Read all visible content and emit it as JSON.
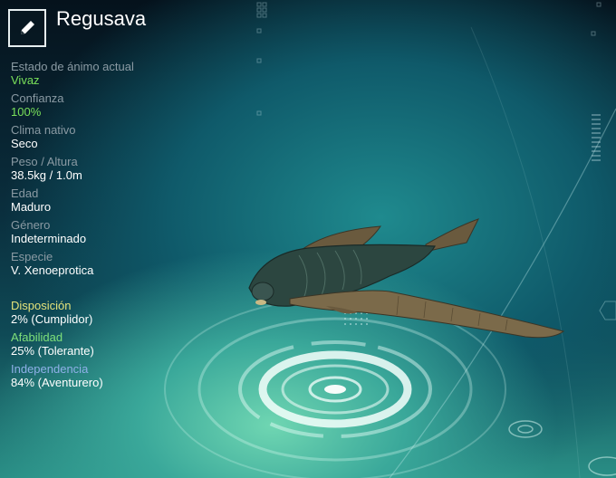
{
  "creature": {
    "name": "Regusava",
    "edit_icon": "pencil-icon"
  },
  "stats": [
    {
      "label": "Estado de ánimo actual",
      "value": "Vivaz",
      "value_color": "#79e05a"
    },
    {
      "label": "Confianza",
      "value": "100%",
      "value_color": "#79e05a"
    },
    {
      "label": "Clima nativo",
      "value": "Seco",
      "value_color": "#ffffff"
    },
    {
      "label": "Peso / Altura",
      "value": "38.5kg / 1.0m",
      "value_color": "#ffffff"
    },
    {
      "label": "Edad",
      "value": "Maduro",
      "value_color": "#ffffff"
    },
    {
      "label": "Género",
      "value": "Indeterminado",
      "value_color": "#ffffff"
    },
    {
      "label": "Especie",
      "value": "V. Xenoeprotica",
      "value_color": "#ffffff"
    }
  ],
  "traits": [
    {
      "label": "Disposición",
      "value": "2% (Cumplidor)",
      "label_color": "#e3e27a"
    },
    {
      "label": "Afabilidad",
      "value": "25% (Tolerante)",
      "label_color": "#7ee07a"
    },
    {
      "label": "Independencia",
      "value": "84% (Aventurero)",
      "label_color": "#8fb0e8"
    }
  ]
}
